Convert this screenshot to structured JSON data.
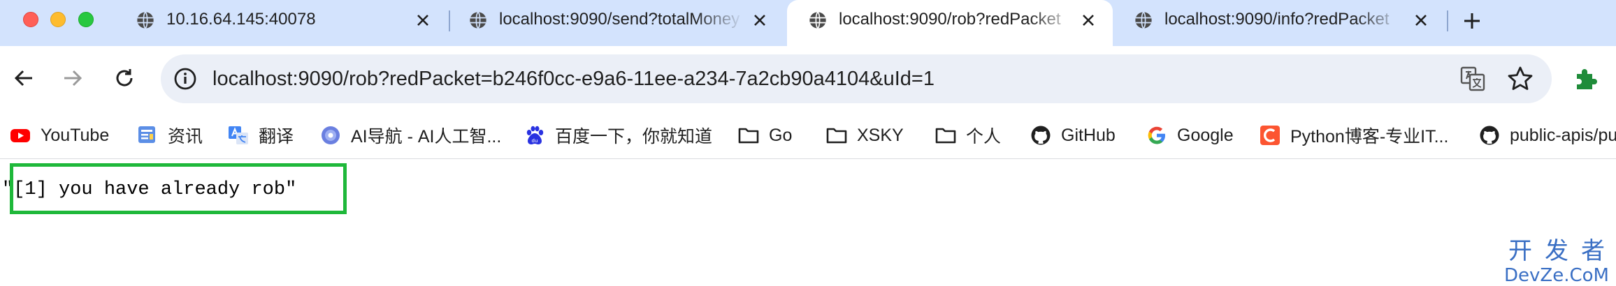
{
  "tabs": [
    {
      "title": "10.16.64.145:40078",
      "active": false
    },
    {
      "title": "localhost:9090/send?totalMoney",
      "active": false
    },
    {
      "title": "localhost:9090/rob?redPacket",
      "active": true
    },
    {
      "title": "localhost:9090/info?redPacket",
      "active": false
    }
  ],
  "toolbar": {
    "url": "localhost:9090/rob?redPacket=b246f0cc-e9a6-11ee-a234-7a2cb90a4104&uId=1"
  },
  "icons": {
    "back": "arrow-left-icon",
    "forward": "arrow-right-icon",
    "reload": "reload-icon",
    "info": "info-icon",
    "translate": "translate-icon",
    "star": "star-icon",
    "extensions": "puzzle-icon",
    "new_tab": "plus-icon"
  },
  "bookmarks": [
    {
      "label": "YouTube",
      "icon": "youtube-icon"
    },
    {
      "label": "资讯",
      "icon": "news-icon"
    },
    {
      "label": "翻译",
      "icon": "translate-icon"
    },
    {
      "label": "AI导航 - AI人工智...",
      "icon": "ai-icon"
    },
    {
      "label": "百度一下，你就知道",
      "icon": "baidu-icon"
    },
    {
      "label": "Go",
      "icon": "folder-icon"
    },
    {
      "label": "XSKY",
      "icon": "folder-icon"
    },
    {
      "label": "个人",
      "icon": "folder-icon"
    },
    {
      "label": "GitHub",
      "icon": "github-icon"
    },
    {
      "label": "Google",
      "icon": "google-icon"
    },
    {
      "label": "Python博客-专业IT...",
      "icon": "csdn-icon"
    },
    {
      "label": "public-apis/pu",
      "icon": "github-icon"
    }
  ],
  "content": {
    "response_text": "\"[1] you have already rob\""
  },
  "watermark": {
    "cn": "开发者",
    "en": "DevZe.CoM"
  },
  "colors": {
    "tabstrip": "#d3e3fd",
    "omnibox": "#ebeff7",
    "highlight_box": "#1fb83a",
    "watermark": "#3a6fc4"
  }
}
